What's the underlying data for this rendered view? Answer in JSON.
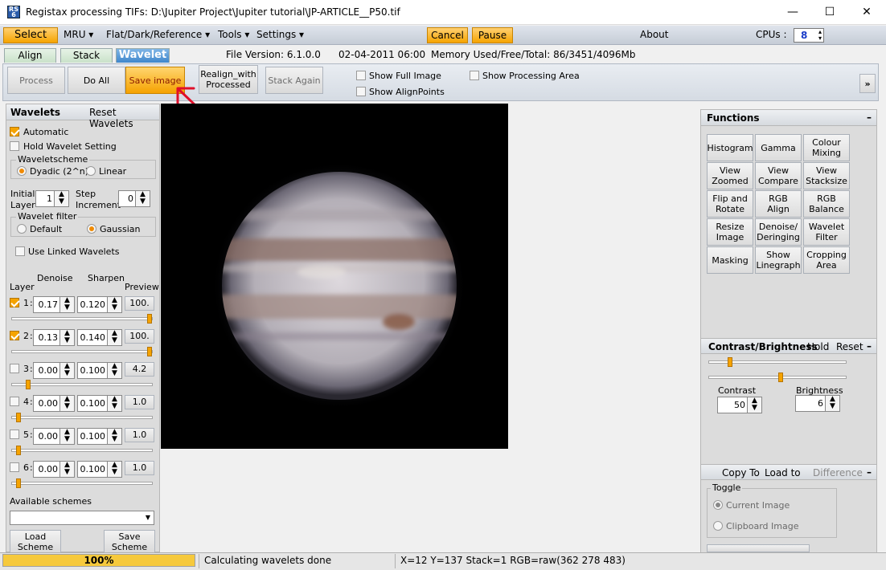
{
  "window": {
    "title": "Registax processing TIFs: D:\\Jupiter Project\\Jupiter tutorial\\JP-ARTICLE__P50.tif",
    "minimize": "—",
    "maximize": "☐",
    "close": "✕"
  },
  "menu": {
    "select": "Select",
    "mru": "MRU ▾",
    "flat": "Flat/Dark/Reference ▾",
    "tools": "Tools ▾",
    "settings": "Settings ▾",
    "cancel": "Cancel",
    "pause": "Pause",
    "about": "About",
    "cpus_label": "CPUs :",
    "cpus_value": "8"
  },
  "tabs": {
    "align": "Align",
    "stack": "Stack",
    "wavelet": "Wavelet"
  },
  "info": {
    "file_version": "File Version: 6.1.0.0",
    "date": "02-04-2011 06:00",
    "memory": "Memory Used/Free/Total: 86/3451/4096Mb"
  },
  "toolbar": {
    "process": "Process",
    "do_all": "Do All",
    "save_image": "Save image",
    "realign_line1": "Realign_with",
    "realign_line2": "Processed",
    "stack_again": "Stack Again",
    "show_full_image": "Show Full Image",
    "show_alignpoints": "Show AlignPoints",
    "show_processing_area": "Show Processing Area",
    "expand": "»"
  },
  "wavelets": {
    "title": "Wavelets",
    "reset": "Reset Wavelets",
    "automatic": "Automatic",
    "hold": "Hold Wavelet Setting",
    "scheme_legend": "Waveletscheme",
    "dyadic": "Dyadic (2^n)",
    "linear": "Linear",
    "initial_l1": "Initial",
    "initial_l2": "Layer",
    "initial_value": "1",
    "step_l1": "Step",
    "step_l2": "Increment",
    "step_value": "0",
    "filter_legend": "Wavelet filter",
    "default": "Default",
    "gaussian": "Gaussian",
    "use_linked": "Use Linked Wavelets",
    "col_layer": "Layer",
    "col_denoise": "Denoise",
    "col_sharpen": "Sharpen",
    "col_preview": "Preview",
    "layers": [
      {
        "num": "1",
        "denoise": "0.17",
        "sharpen": "0.120",
        "preview": "100.",
        "checked": true,
        "level": 1.0
      },
      {
        "num": "2",
        "denoise": "0.13",
        "sharpen": "0.140",
        "preview": "100.",
        "checked": true,
        "level": 1.0
      },
      {
        "num": "3",
        "denoise": "0.00",
        "sharpen": "0.100",
        "preview": "4.2",
        "checked": false,
        "level": 0.1
      },
      {
        "num": "4",
        "denoise": "0.00",
        "sharpen": "0.100",
        "preview": "1.0",
        "checked": false,
        "level": 0.03
      },
      {
        "num": "5",
        "denoise": "0.00",
        "sharpen": "0.100",
        "preview": "1.0",
        "checked": false,
        "level": 0.03
      },
      {
        "num": "6",
        "denoise": "0.00",
        "sharpen": "0.100",
        "preview": "1.0",
        "checked": false,
        "level": 0.03
      }
    ],
    "available_schemes": "Available schemes",
    "load_l1": "Load",
    "load_l2": "Scheme",
    "save_l1": "Save",
    "save_l2": "Scheme"
  },
  "functions": {
    "title": "Functions",
    "collapse": "–",
    "buttons": [
      [
        "Histogram",
        ""
      ],
      [
        "Gamma",
        ""
      ],
      [
        "Colour",
        "Mixing"
      ],
      [
        "View",
        "Zoomed"
      ],
      [
        "View",
        "Compare"
      ],
      [
        "View",
        "Stacksize"
      ],
      [
        "Flip and",
        "Rotate"
      ],
      [
        "RGB",
        "Align"
      ],
      [
        "RGB",
        "Balance"
      ],
      [
        "Resize",
        "Image"
      ],
      [
        "Denoise/",
        "Deringing"
      ],
      [
        "Wavelet",
        "Filter"
      ],
      [
        "Masking",
        ""
      ],
      [
        "Show",
        "Linegraph"
      ],
      [
        "Cropping",
        "Area"
      ]
    ]
  },
  "contrast": {
    "title": "Contrast/Brightness",
    "hold": "Hold",
    "reset": "Reset",
    "collapse": "–",
    "contrast_label": "Contrast",
    "contrast_value": "50",
    "brightness_label": "Brightness",
    "brightness_value": "6",
    "slider1_level": 0.14,
    "slider2_level": 0.52
  },
  "copy": {
    "copy_to": "Copy To",
    "load_to": "Load to",
    "difference": "Difference",
    "collapse": "–",
    "toggle_legend": "Toggle",
    "current_image": "Current Image",
    "clipboard_image": "Clipboard Image"
  },
  "status": {
    "progress": "100%",
    "message": "Calculating wavelets done",
    "coords": "X=12 Y=137 Stack=1 RGB=raw(362 278 483)"
  },
  "colors": {
    "accent_orange": "#f6a400",
    "tab_active": "#3f87cc",
    "arrow": "#e0102a"
  }
}
